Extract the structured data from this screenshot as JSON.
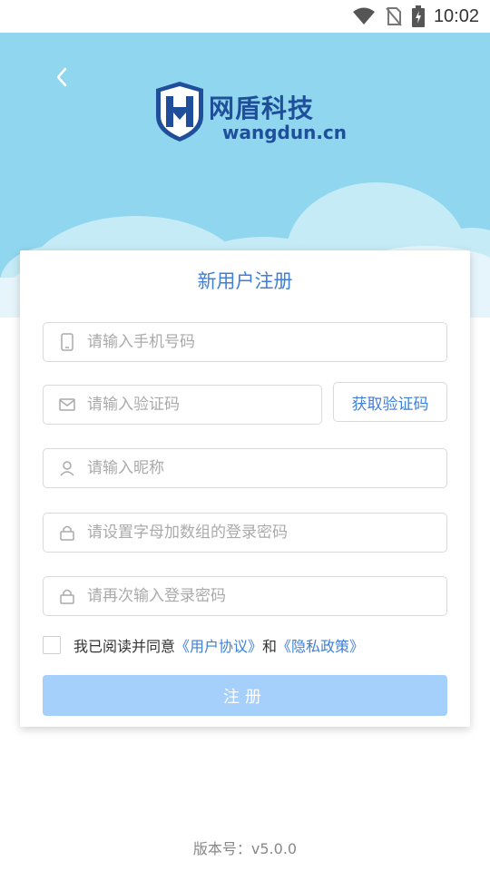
{
  "status_bar": {
    "time": "10:02"
  },
  "header": {
    "logo_cn": "网盾科技",
    "logo_en": "wangdun.cn"
  },
  "form": {
    "title": "新用户注册",
    "phone_placeholder": "请输入手机号码",
    "code_placeholder": "请输入验证码",
    "get_code_label": "获取验证码",
    "nickname_placeholder": "请输入昵称",
    "password_placeholder": "请设置字母加数组的登录密码",
    "confirm_placeholder": "请再次输入登录密码",
    "agree_text": "我已阅读并同意",
    "user_agreement": "《用户协议》",
    "and_text": "和",
    "privacy_policy": "《隐私政策》",
    "submit_label": "注册"
  },
  "footer": {
    "version": "版本号：v5.0.0"
  },
  "colors": {
    "hero_bg": "#8fd6ee",
    "accent": "#3e7fd8",
    "submit_bg": "#a4d0fb",
    "logo": "#1f4f9a"
  }
}
